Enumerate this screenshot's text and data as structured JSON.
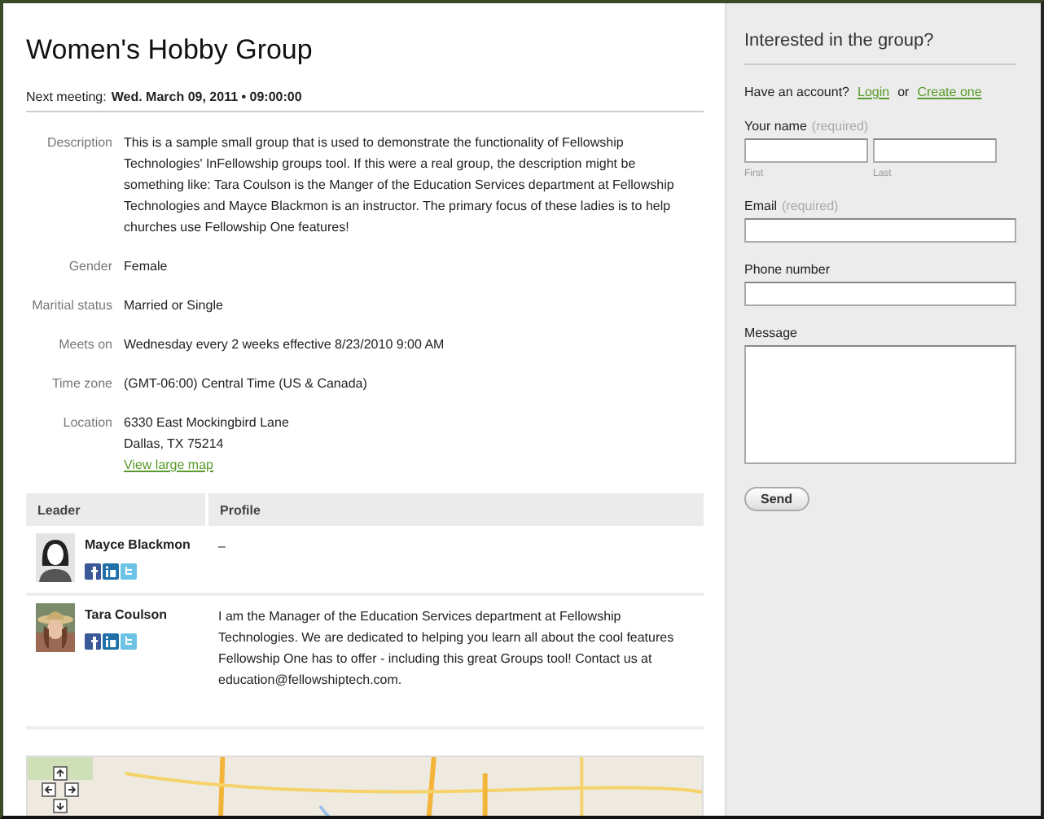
{
  "title": "Women's Hobby Group",
  "next_meeting": {
    "label": "Next meeting:",
    "value": "Wed. March 09, 2011 • 09:00:00"
  },
  "details": [
    {
      "label": "Description",
      "lines": [
        "This is a sample small group that is used to demonstrate the functionality of Fellowship Technologies' InFellowship groups tool. If this were a real group, the description might be something like: Tara Coulson is the Manger of the Education Services department at Fellowship Technologies and Mayce Blackmon is an instructor. The primary focus of these ladies is to help churches use Fellowship One features!"
      ]
    },
    {
      "label": "Gender",
      "lines": [
        "Female"
      ]
    },
    {
      "label": "Maritial status",
      "lines": [
        "Married or Single"
      ]
    },
    {
      "label": "Meets on",
      "lines": [
        "Wednesday every 2 weeks effective 8/23/2010 9:00 AM"
      ]
    },
    {
      "label": "Time zone",
      "lines": [
        "(GMT-06:00) Central Time (US & Canada)"
      ]
    },
    {
      "label": "Location",
      "lines": [
        "6330 East Mockingbird Lane",
        "Dallas, TX 75214"
      ],
      "link": "View large map"
    }
  ],
  "leaders": {
    "columns": [
      "Leader",
      "Profile"
    ],
    "rows": [
      {
        "name": "Mayce Blackmon",
        "profile": "–",
        "kind": "silhouette"
      },
      {
        "name": "Tara Coulson",
        "profile": "I am the Manager of the Education Services department at Fellowship Technologies. We are dedicated to helping you learn all about the cool features Fellowship One has to offer - including this great Groups tool! Contact us at education@fellowshiptech.com."
      }
    ]
  },
  "sidebar": {
    "heading": "Interested in the group?",
    "account": {
      "question": "Have an account?",
      "login": "Login",
      "or": "or",
      "create": "Create one"
    },
    "fields": [
      {
        "kind": "name",
        "label": "Your name",
        "hint": "(required)",
        "sublabels": [
          "First",
          "Last"
        ]
      },
      {
        "kind": "text",
        "label": "Email",
        "hint": "(required)"
      },
      {
        "kind": "text",
        "label": "Phone number"
      },
      {
        "kind": "textarea",
        "label": "Message"
      }
    ],
    "button": "Send"
  }
}
